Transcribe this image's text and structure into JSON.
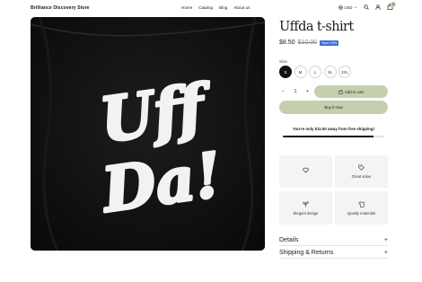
{
  "header": {
    "brand": "Brilliance Discovery Store",
    "nav": [
      "Home",
      "Catalog",
      "Blog",
      "About us"
    ],
    "currency": "USD",
    "cart_count": "0"
  },
  "product": {
    "image_text_line1": "Uff",
    "image_text_line2": "Da!",
    "title": "Uffda t-shirt",
    "price": "$8.50",
    "compare_price": "$10.00",
    "save_badge": "Save 15%",
    "size_label": "Size",
    "sizes": [
      "S",
      "M",
      "L",
      "XL",
      "2XL"
    ],
    "selected_size": "S",
    "quantity": "1",
    "qty_minus": "−",
    "qty_plus": "+",
    "add_to_cart": "Add to cart",
    "buy_now": "Buy it now"
  },
  "shipping": {
    "message": "You're only $11.50 away from free shipping!",
    "progress_fraction": 0.89
  },
  "features": [
    {
      "label": "",
      "icon": "heart-icon"
    },
    {
      "label": "Great value",
      "icon": "tag-icon"
    },
    {
      "label": "Elegant design",
      "icon": "plant-icon"
    },
    {
      "label": "Quality materials",
      "icon": "shirt-icon"
    }
  ],
  "accordions": [
    {
      "label": "Details",
      "toggle": "+"
    },
    {
      "label": "Shipping & Returns",
      "toggle": "+"
    }
  ],
  "colors": {
    "accent_button": "#c5cfad",
    "badge": "#3f6dd9",
    "image_bg": "#101010"
  }
}
